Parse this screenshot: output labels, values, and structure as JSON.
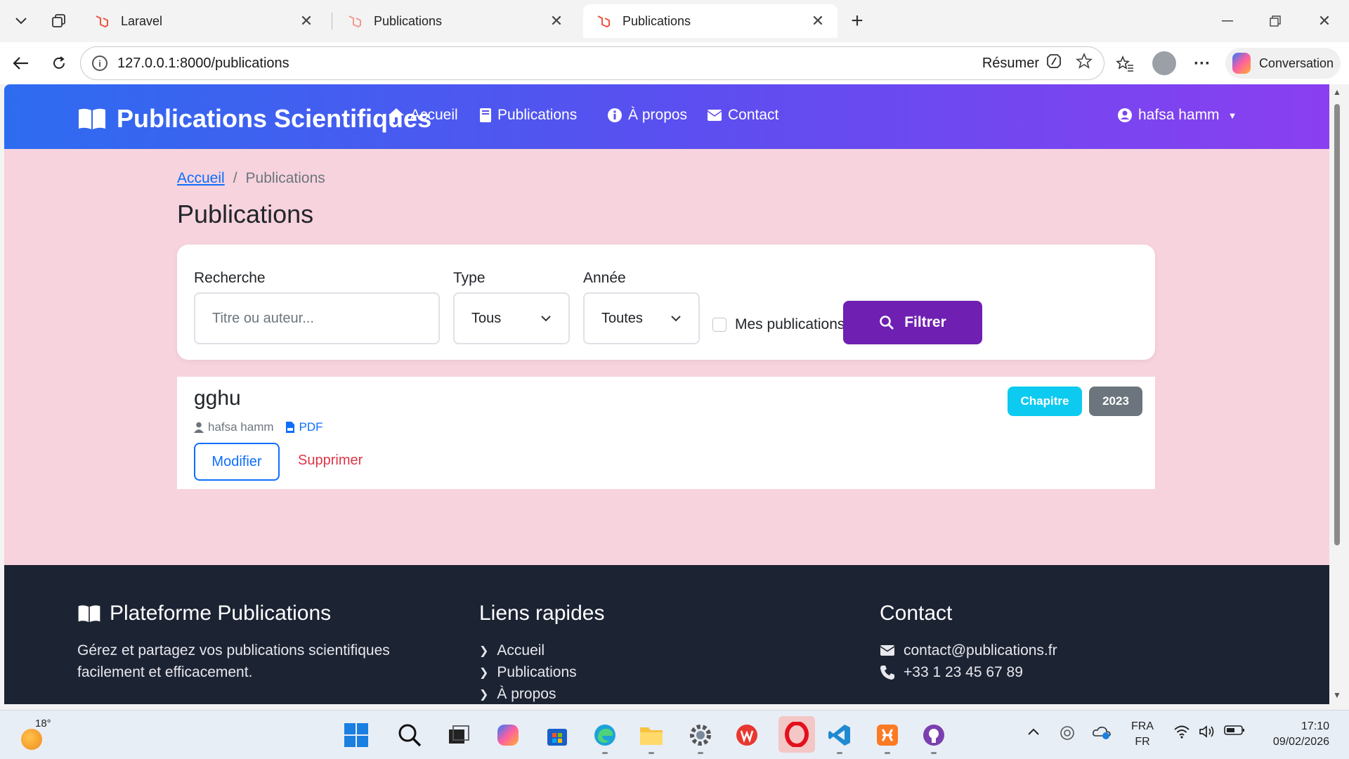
{
  "browser": {
    "tabs": [
      {
        "label": "Laravel",
        "active": false
      },
      {
        "label": "Publications",
        "active": false
      },
      {
        "label": "Publications",
        "active": true
      }
    ],
    "url": "127.0.0.1:8000/publications",
    "resume_label": "Résumer",
    "copilot_label": "Conversation"
  },
  "navbar": {
    "brand": "Publications Scientifiques",
    "links": [
      "Accueil",
      "Publications",
      "À propos",
      "Contact"
    ],
    "user": "hafsa hamm"
  },
  "breadcrumb": {
    "home": "Accueil",
    "separator": "/",
    "current": "Publications"
  },
  "page_title": "Publications",
  "filters": {
    "search_label": "Recherche",
    "search_placeholder": "Titre ou auteur...",
    "type_label": "Type",
    "type_value": "Tous",
    "year_label": "Année",
    "year_value": "Toutes",
    "mine_label": "Mes publications",
    "mine_checked": false,
    "submit_label": "Filtrer"
  },
  "publications": [
    {
      "title": "gghu",
      "author": "hafsa hamm",
      "file_label": "PDF",
      "type": "Chapitre",
      "year": "2023",
      "edit_label": "Modifier",
      "delete_label": "Supprimer"
    }
  ],
  "footer": {
    "brand_title": "Plateforme Publications",
    "brand_text": "Gérez et partagez vos publications scientifiques facilement et efficacement.",
    "links_title": "Liens rapides",
    "links": [
      "Accueil",
      "Publications",
      "À propos"
    ],
    "contact_title": "Contact",
    "email": "contact@publications.fr",
    "phone": "+33 1 23 45 67 89"
  },
  "taskbar": {
    "temperature": "18°",
    "lang_1": "FRA",
    "lang_2": "FR",
    "time": "17:10",
    "date": "09/02/2026"
  },
  "colors": {
    "nav_gradient_start": "#2d6cf0",
    "nav_gradient_end": "#8a3ff0",
    "page_bg": "#f7d3de",
    "filter_button": "#6f1fb2",
    "badge_type": "#0dcaf0",
    "badge_year": "#6c757d",
    "footer_bg": "#1c2333",
    "danger": "#dc3545",
    "primary": "#0d6efd"
  }
}
